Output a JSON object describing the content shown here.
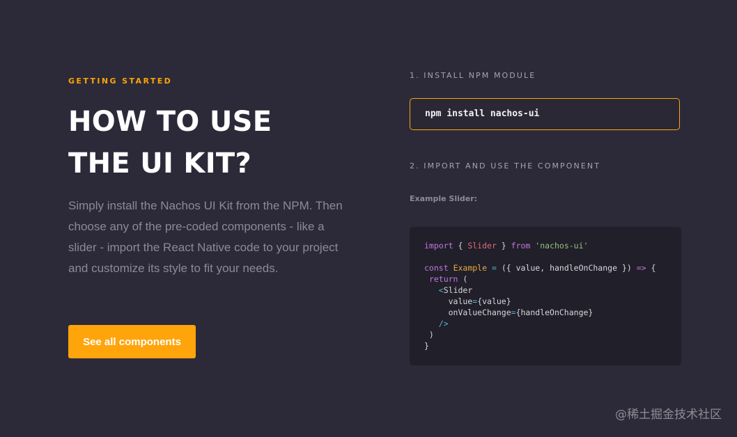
{
  "hero": {
    "eyebrow": "GETTING STARTED",
    "heading_line1": "HOW TO USE",
    "heading_line2": "THE UI KIT?",
    "lead": "Simply install the Nachos UI Kit from the NPM. Then choose any of the pre-coded components  - like a slider - import the React Native code to your project and customize its style to fit your needs.",
    "cta_label": "See all components"
  },
  "steps": {
    "step1_label": "1. INSTALL NPM MODULE",
    "install_command": "npm install nachos-ui",
    "step2_label": "2. IMPORT AND USE THE COMPONENT",
    "example_label": "Example Slider:"
  },
  "code": {
    "lines": [
      [
        {
          "t": "kw",
          "v": "import"
        },
        {
          "t": "plain",
          "v": " { "
        },
        {
          "t": "cls",
          "v": "Slider"
        },
        {
          "t": "plain",
          "v": " } "
        },
        {
          "t": "kw",
          "v": "from"
        },
        {
          "t": "plain",
          "v": " "
        },
        {
          "t": "str",
          "v": "'nachos-ui'"
        }
      ],
      [],
      [
        {
          "t": "kw",
          "v": "const"
        },
        {
          "t": "plain",
          "v": " "
        },
        {
          "t": "fn",
          "v": "Example"
        },
        {
          "t": "plain",
          "v": " "
        },
        {
          "t": "op",
          "v": "="
        },
        {
          "t": "plain",
          "v": " ({ value, handleOnChange }) "
        },
        {
          "t": "kw",
          "v": "=>"
        },
        {
          "t": "plain",
          "v": " {"
        }
      ],
      [
        {
          "t": "plain",
          "v": " "
        },
        {
          "t": "kw",
          "v": "return"
        },
        {
          "t": "plain",
          "v": " ("
        }
      ],
      [
        {
          "t": "plain",
          "v": "   "
        },
        {
          "t": "tag",
          "v": "<"
        },
        {
          "t": "plain",
          "v": "Slider"
        }
      ],
      [
        {
          "t": "plain",
          "v": "     value"
        },
        {
          "t": "op",
          "v": "="
        },
        {
          "t": "plain",
          "v": "{value}"
        }
      ],
      [
        {
          "t": "plain",
          "v": "     onValueChange"
        },
        {
          "t": "op",
          "v": "="
        },
        {
          "t": "plain",
          "v": "{handleOnChange}"
        }
      ],
      [
        {
          "t": "plain",
          "v": "   "
        },
        {
          "t": "tag",
          "v": "/>"
        }
      ],
      [
        {
          "t": "plain",
          "v": " )"
        }
      ],
      [
        {
          "t": "plain",
          "v": "}"
        }
      ]
    ]
  },
  "watermark": "@稀土掘金技术社区",
  "colors": {
    "background": "#2c2a38",
    "accent": "#ffa40b",
    "code_background": "#201f2a"
  }
}
